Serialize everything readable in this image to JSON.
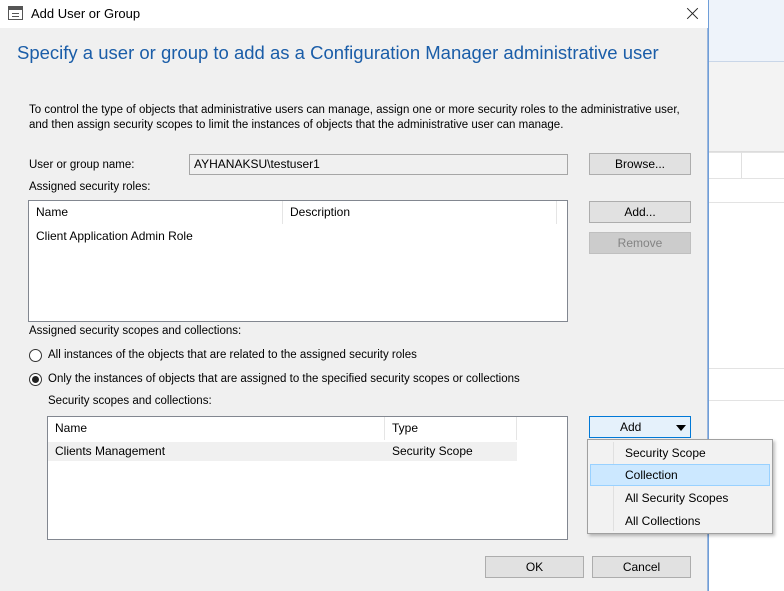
{
  "dialog": {
    "title": "Add User or Group",
    "header": "Specify a user or group to add as a Configuration Manager administrative user",
    "instructions": "To control the type of objects that administrative users can manage, assign one or more security roles  to the  administrative user, and then assign security scopes to limit the instances of objects that the administrative user can manage."
  },
  "user": {
    "label": "User or group name:",
    "value": "AYHANAKSU\\testuser1",
    "browse_label": "Browse..."
  },
  "roles": {
    "label": "Assigned security roles:",
    "columns": [
      "Name",
      "Description"
    ],
    "rows": [
      {
        "name": "Client Application Admin Role",
        "description": ""
      }
    ],
    "add_label": "Add...",
    "remove_label": "Remove"
  },
  "scopes": {
    "label": "Assigned security scopes and collections:",
    "radio_all": "All instances of the objects that are related to the assigned security roles",
    "radio_only": "Only the instances of objects that are assigned to the specified security scopes or collections",
    "list_label": "Security scopes and collections:",
    "columns": [
      "Name",
      "Type"
    ],
    "rows": [
      {
        "name": "Clients Management",
        "type": "Security Scope"
      }
    ],
    "add_label": "Add",
    "menu": [
      "Security Scope",
      "Collection",
      "All Security Scopes",
      "All Collections"
    ]
  },
  "footer": {
    "ok_label": "OK",
    "cancel_label": "Cancel"
  }
}
